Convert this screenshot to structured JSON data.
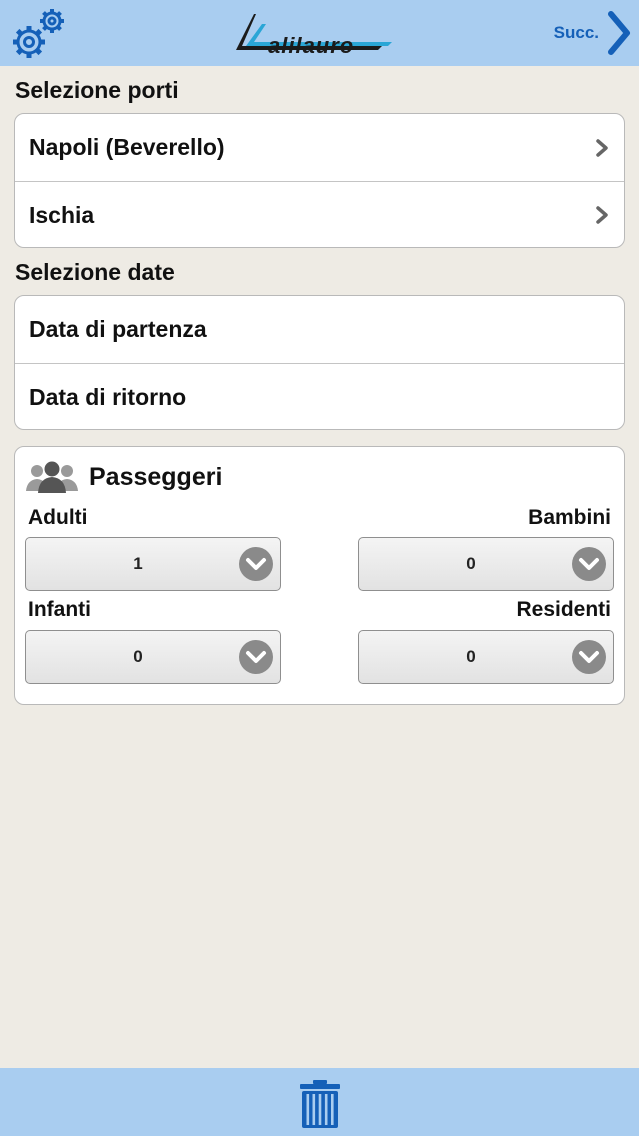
{
  "header": {
    "logo_text": "alilauro",
    "next_label": "Succ."
  },
  "ports": {
    "title": "Selezione porti",
    "from": "Napoli (Beverello)",
    "to": "Ischia"
  },
  "dates": {
    "title": "Selezione date",
    "departure": "Data di partenza",
    "return": "Data di ritorno"
  },
  "passengers": {
    "title": "Passeggeri",
    "adults": {
      "label": "Adulti",
      "value": "1"
    },
    "children": {
      "label": "Bambini",
      "value": "0"
    },
    "infants": {
      "label": "Infanti",
      "value": "0"
    },
    "residents": {
      "label": "Residenti",
      "value": "0"
    }
  },
  "colors": {
    "bar": "#a9cdf0",
    "accent": "#1560b8",
    "background": "#eeebe4"
  },
  "icons": {
    "settings": "gear-icon",
    "next": "chevron-right-icon",
    "row_disclosure": "chevron-right-icon",
    "passengers": "people-icon",
    "dropdown": "chevron-down-circle-icon",
    "delete": "trash-icon"
  }
}
